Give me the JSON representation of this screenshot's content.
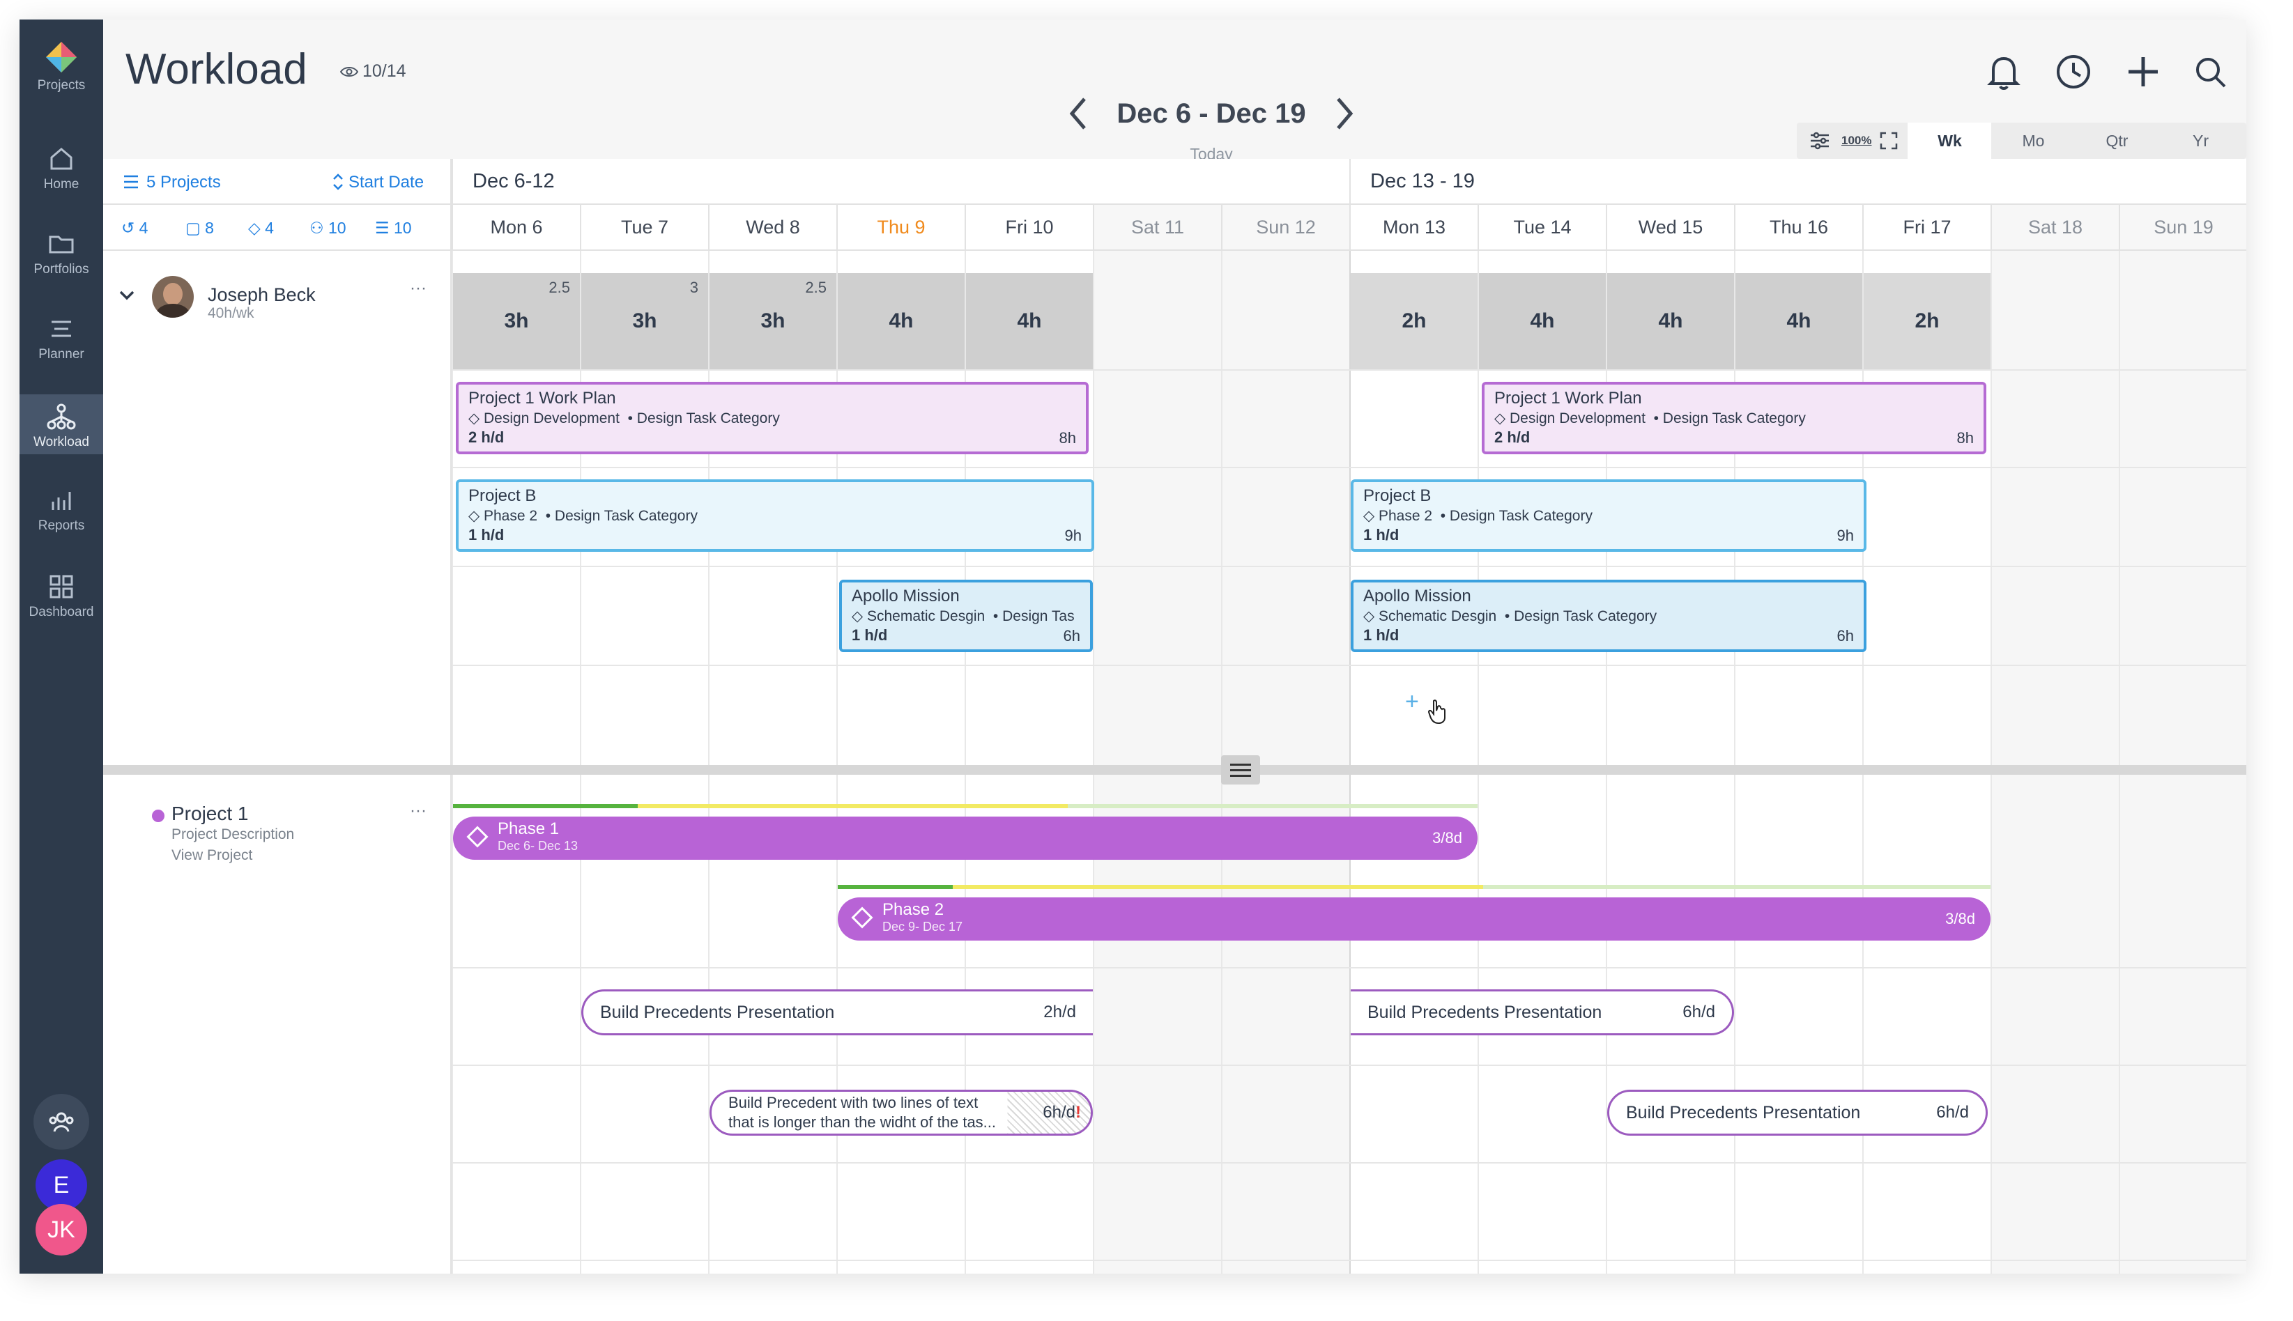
{
  "sidebar": {
    "logo_label": "Projects",
    "items": [
      {
        "label": "Home",
        "icon": "home-icon"
      },
      {
        "label": "Portfolios",
        "icon": "folder-icon"
      },
      {
        "label": "Planner",
        "icon": "planner-icon"
      },
      {
        "label": "Workload",
        "icon": "workload-icon",
        "active": true
      },
      {
        "label": "Reports",
        "icon": "reports-icon"
      },
      {
        "label": "Dashboard",
        "icon": "dashboard-icon"
      }
    ],
    "team_icon": "team-icon",
    "user_e": "E",
    "user_jk": "JK"
  },
  "header": {
    "title": "Workload",
    "views": "10/14",
    "date_range": "Dec 6 - Dec 19",
    "today": "Today",
    "zoom": "100%",
    "scales": [
      "Wk",
      "Mo",
      "Qtr",
      "Yr"
    ],
    "active_scale": "Wk"
  },
  "filters": {
    "projects": "5 Projects",
    "sort": "Start Date",
    "counts": [
      "4",
      "8",
      "4",
      "10",
      "10"
    ]
  },
  "timeline": {
    "weeks": [
      "Dec 6-12",
      "Dec 13 - 19"
    ],
    "days": [
      "Mon 6",
      "Tue 7",
      "Wed 8",
      "Thu 9",
      "Fri 10",
      "Sat 11",
      "Sun 12",
      "Mon 13",
      "Tue 14",
      "Wed 15",
      "Thu 16",
      "Fri 17",
      "Sat 18",
      "Sun 19"
    ]
  },
  "member": {
    "name": "Joseph Beck",
    "capacity": "40h/wk",
    "more": "···",
    "daily": [
      {
        "hours": "3h",
        "small": "2.5"
      },
      {
        "hours": "3h",
        "small": "3"
      },
      {
        "hours": "3h",
        "small": "2.5"
      },
      {
        "hours": "4h",
        "small": ""
      },
      {
        "hours": "4h",
        "small": ""
      },
      {
        "hours": "",
        "small": ""
      },
      {
        "hours": "",
        "small": ""
      },
      {
        "hours": "2h",
        "small": ""
      },
      {
        "hours": "4h",
        "small": ""
      },
      {
        "hours": "4h",
        "small": ""
      },
      {
        "hours": "4h",
        "small": ""
      },
      {
        "hours": "2h",
        "small": ""
      },
      {
        "hours": "",
        "small": ""
      },
      {
        "hours": "",
        "small": ""
      }
    ]
  },
  "bars": [
    {
      "title": "Project 1 Work Plan",
      "phase": "Design Development",
      "category": "Design Task Category",
      "rate": "2 h/d",
      "total": "8h"
    },
    {
      "title": "Project 1 Work Plan",
      "phase": "Design Development",
      "category": "Design Task Category",
      "rate": "2 h/d",
      "total": "8h"
    },
    {
      "title": "Project B",
      "phase": "Phase 2",
      "category": "Design Task Category",
      "rate": "1 h/d",
      "total": "9h"
    },
    {
      "title": "Project B",
      "phase": "Phase 2",
      "category": "Design Task Category",
      "rate": "1 h/d",
      "total": "9h"
    },
    {
      "title": "Apollo Mission",
      "phase": "Schematic Desgin",
      "category": "Design Tas",
      "rate": "1 h/d",
      "total": "6h"
    },
    {
      "title": "Apollo Mission",
      "phase": "Schematic Desgin",
      "category": "Design Task Category",
      "rate": "1 h/d",
      "total": "6h"
    }
  ],
  "project": {
    "name": "Project 1",
    "description": "Project Description",
    "link": "View Project",
    "more": "···",
    "color": "#b863d6"
  },
  "phases": [
    {
      "name": "Phase 1",
      "dates": "Dec 6- Dec 13",
      "rate": "3/8d"
    },
    {
      "name": "Phase 2",
      "dates": "Dec 9- Dec 17",
      "rate": "3/8d"
    }
  ],
  "pills": [
    {
      "title": "Build Precedents Presentation",
      "rate": "2h/d"
    },
    {
      "title": "Build Precedents Presentation",
      "rate": "6h/d"
    },
    {
      "title": "Build Precedent with two lines of text that is longer than the widht of the tas...",
      "rate": "6h/d"
    },
    {
      "title": "Build Precedents Presentation",
      "rate": "6h/d"
    }
  ],
  "help_label": "?"
}
